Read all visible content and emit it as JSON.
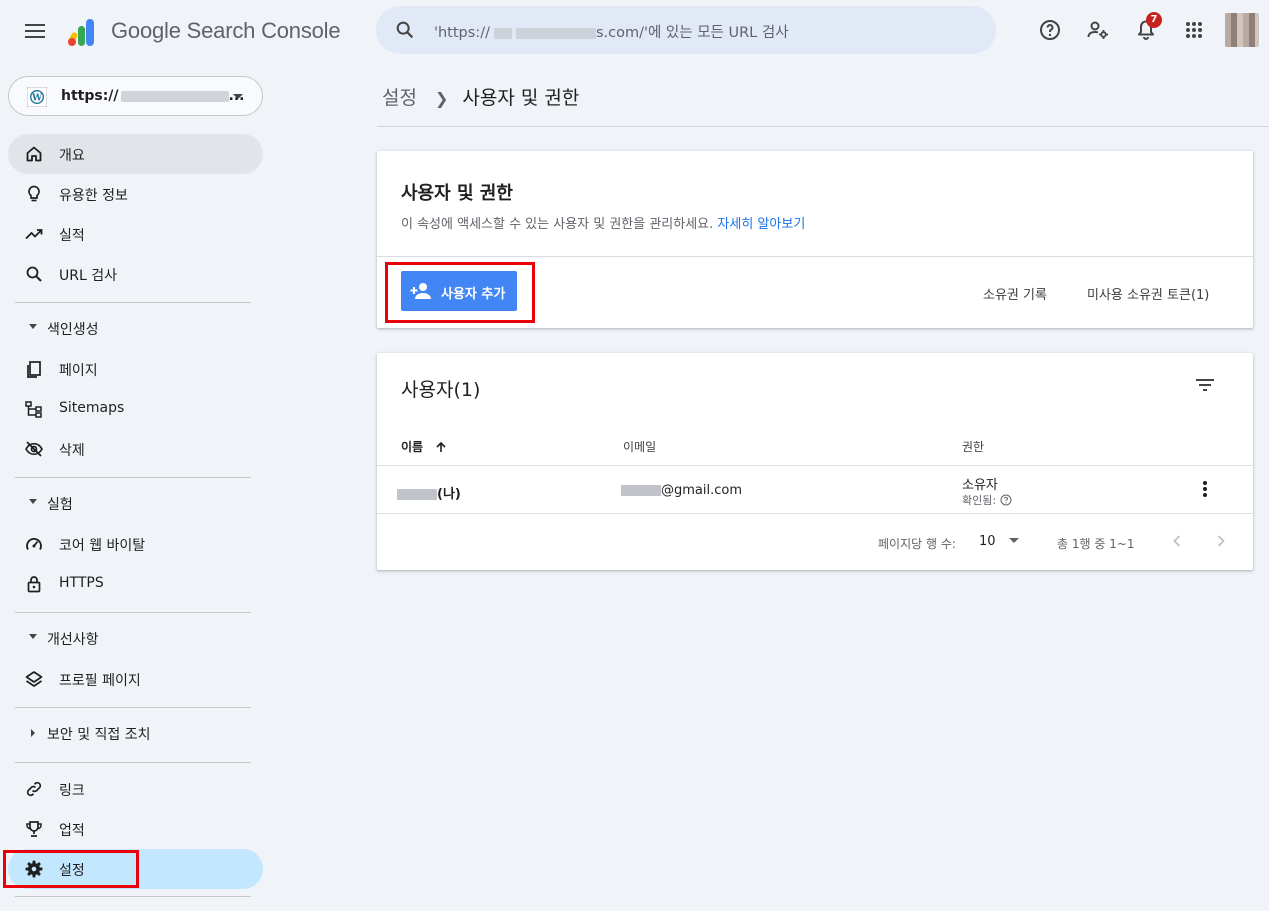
{
  "header": {
    "app_name": "Google Search Console",
    "search": {
      "prefix": "'https://",
      "suffix": "s.com/'에 있는 모든 URL 검사"
    },
    "notification_count": "7"
  },
  "sidebar": {
    "property_url": "https://",
    "property_ellipsis": "...",
    "items": {
      "overview": "개요",
      "insights": "유용한 정보",
      "performance": "실적",
      "url_inspection": "URL 검사",
      "indexing_section": "색인생성",
      "pages": "페이지",
      "sitemaps": "Sitemaps",
      "removals": "삭제",
      "experience_section": "실험",
      "cwv": "코어 웹 바이탈",
      "https": "HTTPS",
      "enhancements_section": "개선사항",
      "profile_page": "프로필 페이지",
      "security_section": "보안 및 직접 조치",
      "links": "링크",
      "achievements": "업적",
      "settings": "설정"
    }
  },
  "breadcrumb": {
    "parent": "설정",
    "current": "사용자 및 권한"
  },
  "permissions_card": {
    "title": "사용자 및 권한",
    "description": "이 속성에 액세스할 수 있는 사용자 및 권한을 관리하세요.",
    "learn_more": "자세히 알아보기",
    "add_user": "사용자 추가",
    "ownership_history": "소유권 기록",
    "unused_tokens": "미사용 소유권 토큰(1)"
  },
  "users_card": {
    "title": "사용자(1)",
    "columns": {
      "name": "이름",
      "email": "이메일",
      "permission": "권한"
    },
    "row": {
      "name_suffix": "(나)",
      "email_suffix": "@gmail.com",
      "permission": "소유자",
      "verified": "확인됨:"
    },
    "pagination": {
      "rows_per_page_label": "페이지당 행 수:",
      "rows_per_page_value": "10",
      "range": "총 1행 중 1~1"
    }
  },
  "colors": {
    "accent": "#4285f4",
    "selected_nav": "#c2e7ff",
    "highlight_box": "#e8000b",
    "link": "#1a73e8"
  }
}
